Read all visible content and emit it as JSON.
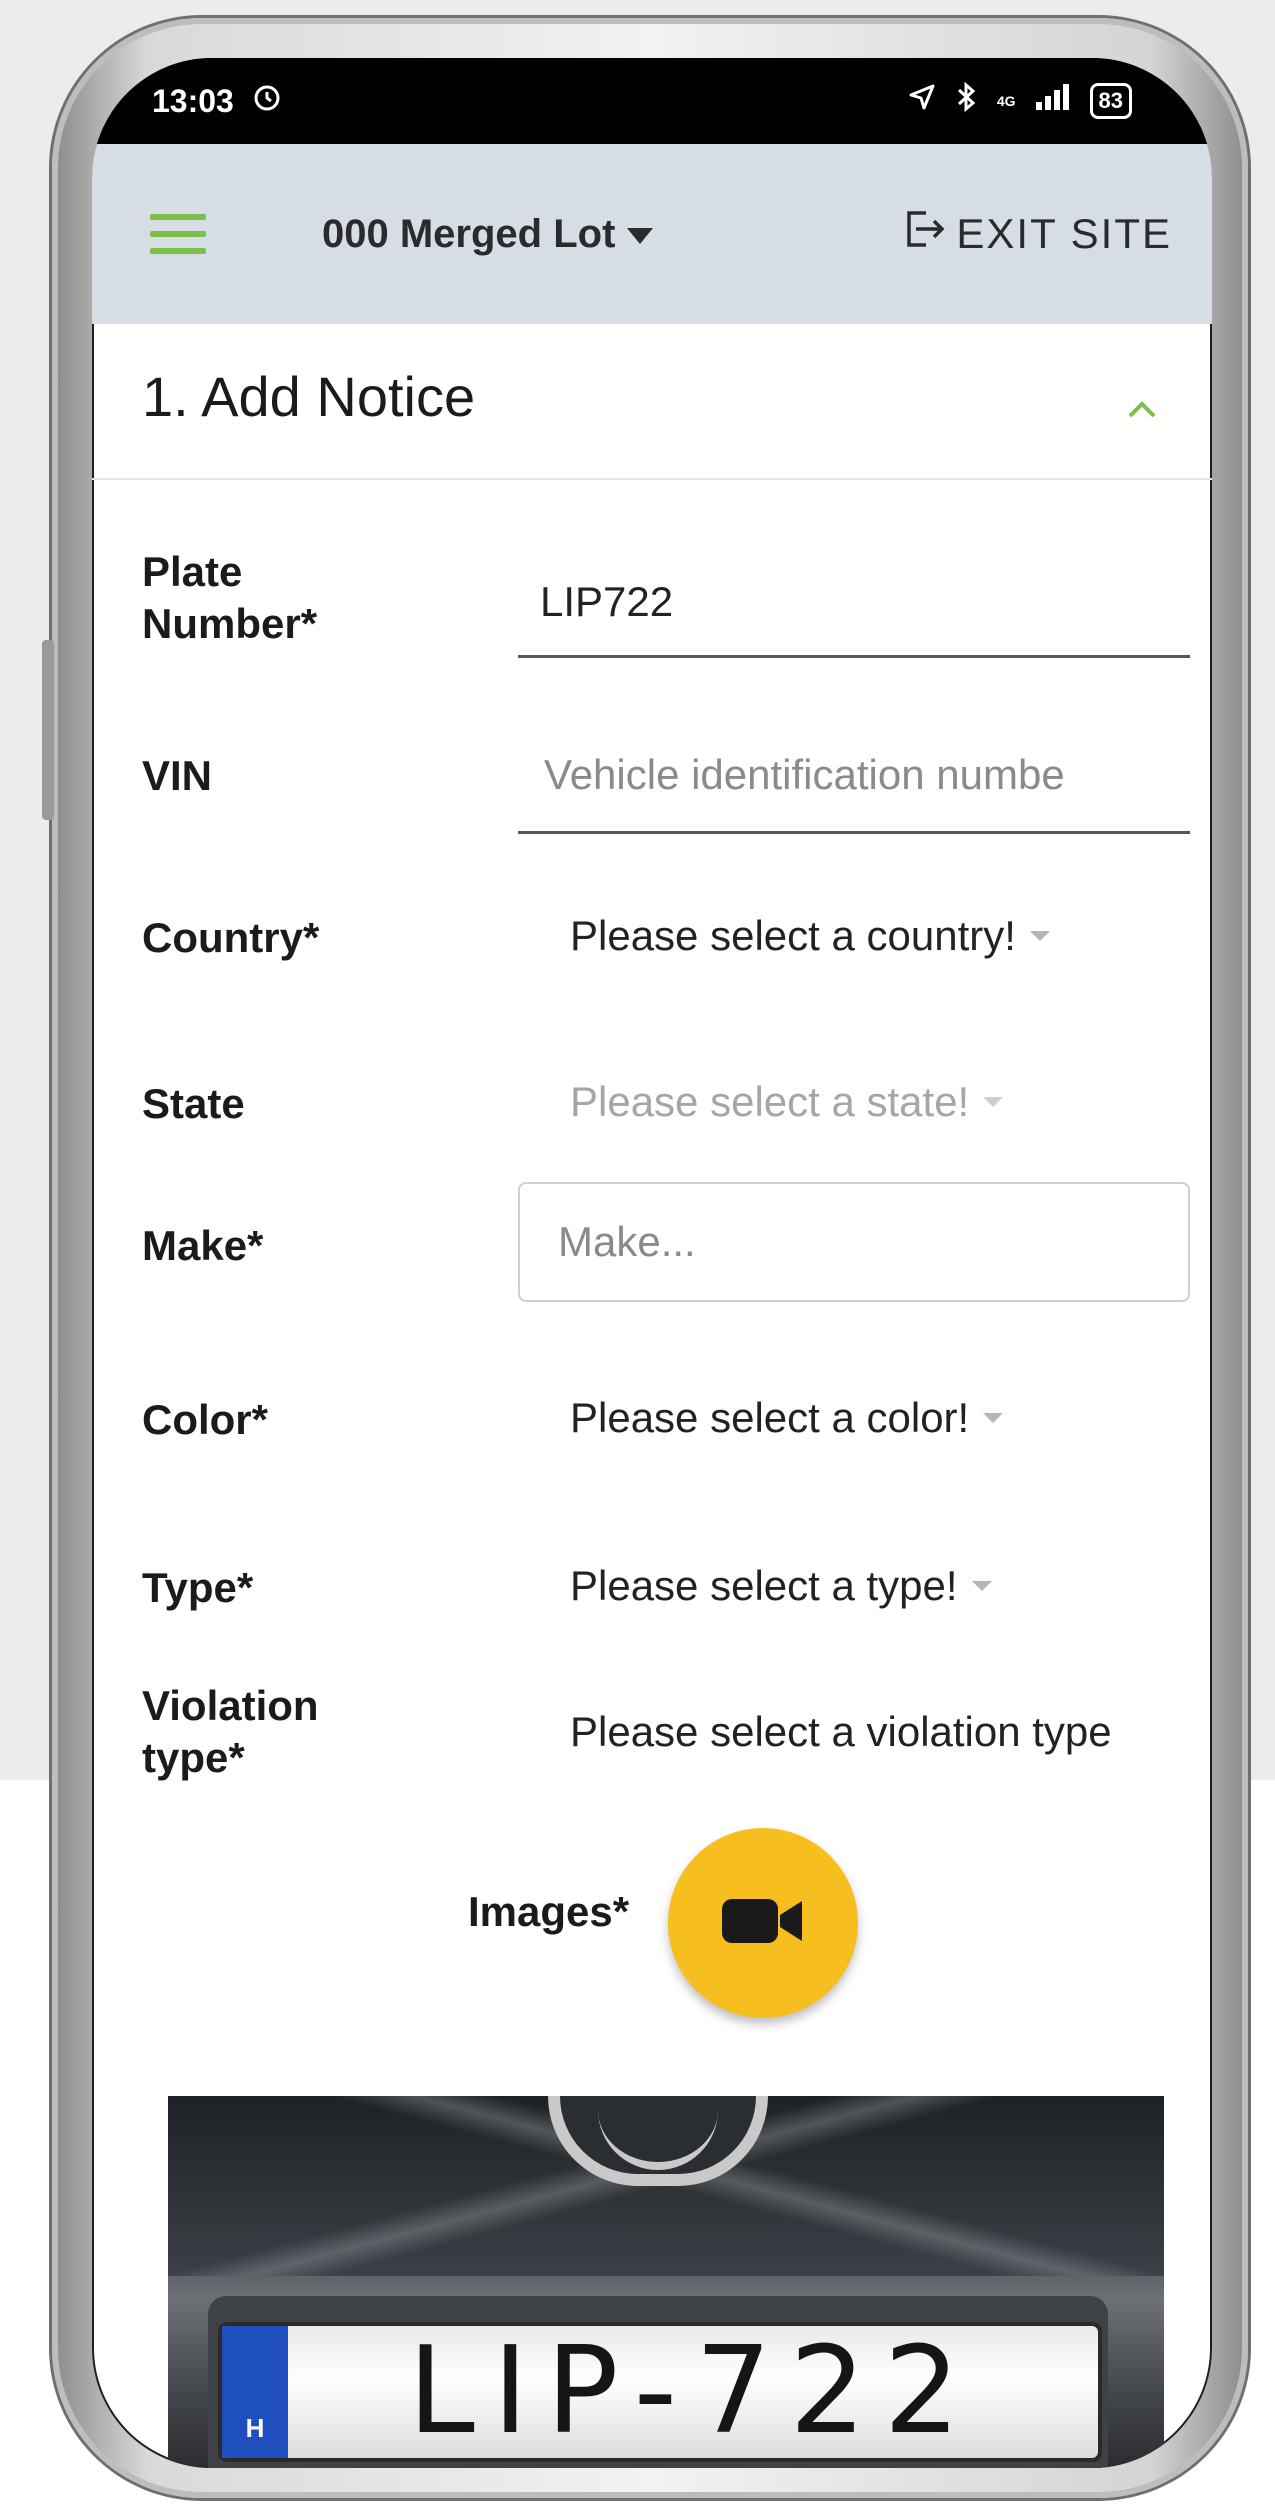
{
  "status_bar": {
    "time": "13:03",
    "battery": "83",
    "network": "4G"
  },
  "app_bar": {
    "lot_name": "000 Merged Lot",
    "exit_label": "EXIT SITE",
    "accent_color": "#7cbf4b"
  },
  "section": {
    "title": "1. Add Notice"
  },
  "form": {
    "plate": {
      "label_line1": "Plate",
      "label_line2": "Number*",
      "value": "LIP722"
    },
    "vin": {
      "label": "VIN",
      "placeholder": "Vehicle identification numbe"
    },
    "country": {
      "label": "Country*",
      "value": "Please select a country!"
    },
    "state": {
      "label": "State",
      "value": "Please select a state!"
    },
    "make": {
      "label": "Make*",
      "placeholder": "Make..."
    },
    "color": {
      "label": "Color*",
      "value": "Please select a color!"
    },
    "type": {
      "label": "Type*",
      "value": "Please select a type!"
    },
    "violation": {
      "label_line1": "Violation",
      "label_line2": "type*",
      "value": "Please select a violation type"
    },
    "images": {
      "label": "Images*",
      "button_color": "#f6bf1f"
    }
  },
  "photo": {
    "plate_country": "H",
    "plate_text": "LIP-722"
  },
  "icons": {
    "menu": "hamburger-icon",
    "dropdown": "caret-down-icon",
    "exit": "exit-icon",
    "collapse": "chevron-up-icon",
    "camera": "video-camera-icon",
    "alarm": "alarm-clock-icon",
    "location": "location-arrow-icon",
    "bluetooth": "bluetooth-icon",
    "signal": "signal-icon",
    "battery": "battery-icon"
  }
}
